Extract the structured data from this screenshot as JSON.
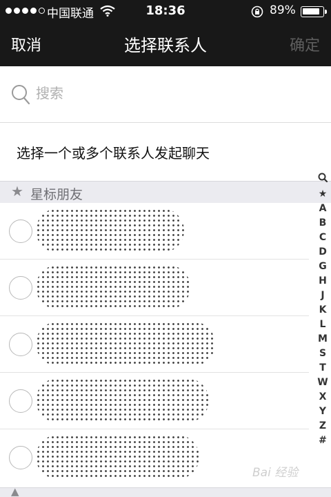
{
  "status_bar": {
    "signal_dots_filled": 4,
    "signal_dots_total": 5,
    "carrier": "中国联通",
    "time": "18:36",
    "battery_percent_text": "89%",
    "battery_level": 0.89
  },
  "nav": {
    "cancel_label": "取消",
    "title": "选择联系人",
    "confirm_label": "确定"
  },
  "search": {
    "placeholder": "搜索"
  },
  "hint": "选择一个或多个联系人发起聊天",
  "section": {
    "star": "★",
    "label": "星标朋友"
  },
  "contacts": [
    {
      "name_width_fraction": 0.48,
      "selected": false
    },
    {
      "name_width_fraction": 0.5,
      "selected": false
    },
    {
      "name_width_fraction": 0.58,
      "selected": false
    },
    {
      "name_width_fraction": 0.56,
      "selected": false
    },
    {
      "name_width_fraction": 0.53,
      "selected": false
    }
  ],
  "index_bar": [
    "🔍",
    "★",
    "A",
    "B",
    "C",
    "D",
    "G",
    "H",
    "J",
    "K",
    "L",
    "M",
    "S",
    "T",
    "W",
    "X",
    "Y",
    "Z",
    "#"
  ],
  "watermark": "Bai 经验",
  "colors": {
    "nav_background": "#181818",
    "confirm_disabled": "#5e5e5e",
    "section_background": "#ebebf0"
  }
}
